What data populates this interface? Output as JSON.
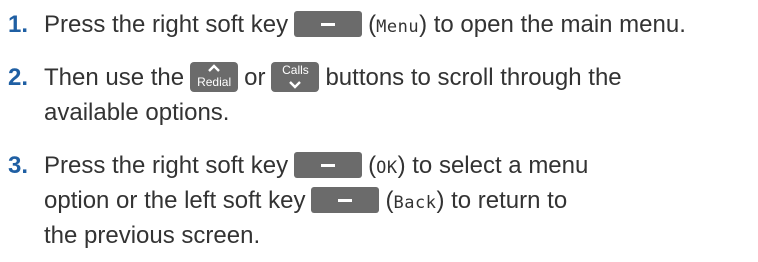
{
  "steps": [
    {
      "number": "1.",
      "line1": {
        "before": "Press the right soft key",
        "paren_open": "(",
        "lcd": "Menu",
        "after": ") to open the main menu."
      }
    },
    {
      "number": "2.",
      "line1": {
        "before": "Then use the",
        "key1": "Redial",
        "middle": "or",
        "key2": "Calls",
        "after": "buttons to scroll through the"
      },
      "line2": "available options."
    },
    {
      "number": "3.",
      "line1": {
        "before": "Press the right soft key",
        "paren_open": "(",
        "lcd": "OK",
        "after": ") to select a menu"
      },
      "line2": {
        "before": "option or the left soft key",
        "paren_open": "(",
        "lcd": "Back",
        "after": ") to return to"
      },
      "line3": "the previous screen."
    }
  ],
  "icons": {
    "soft_key": "soft-key-minus-icon",
    "up": "chevron-up-icon",
    "down": "chevron-down-icon"
  },
  "colors": {
    "step_number": "#1f5fa3",
    "text": "#333333",
    "key": "#6b6b6b"
  }
}
